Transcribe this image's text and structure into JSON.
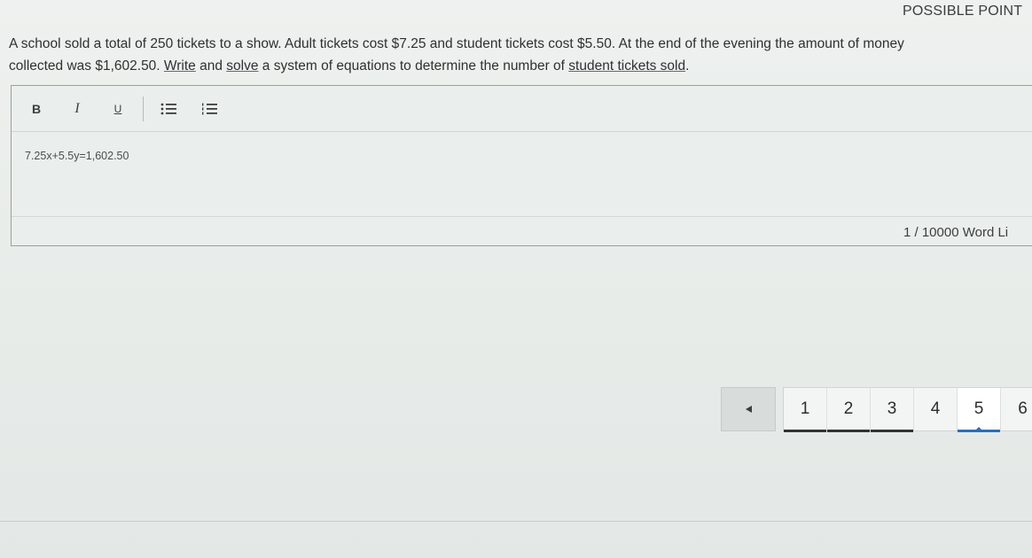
{
  "header": {
    "possible_points": "POSSIBLE POINT"
  },
  "question": {
    "line1": "A school sold a total of 250 tickets to a show.  Adult tickets cost $7.25 and student tickets cost $5.50.  At the end of the evening the amount of money",
    "line2_prefix": "collected was $1,602.50.  ",
    "line2_write": "Write",
    "line2_and": " and ",
    "line2_solve": "solve",
    "line2_mid": " a system of equations to determine the number of ",
    "line2_target": "student tickets sold",
    "line2_end": "."
  },
  "toolbar": {
    "bold": "B",
    "italic": "I",
    "underline": "U",
    "icons": [
      "bold-icon",
      "italic-icon",
      "underline-icon",
      "bulleted-list-icon",
      "numbered-list-icon"
    ]
  },
  "editor": {
    "answer_text": "7.25x+5.5y=1,602.50",
    "word_limit": "1 / 10000 Word Li"
  },
  "pagination": {
    "prev_icon": "left-arrow-icon",
    "pages": [
      "1",
      "2",
      "3",
      "4",
      "5",
      "6"
    ],
    "current_page": "5",
    "accent_color": "#2a6fb8"
  }
}
